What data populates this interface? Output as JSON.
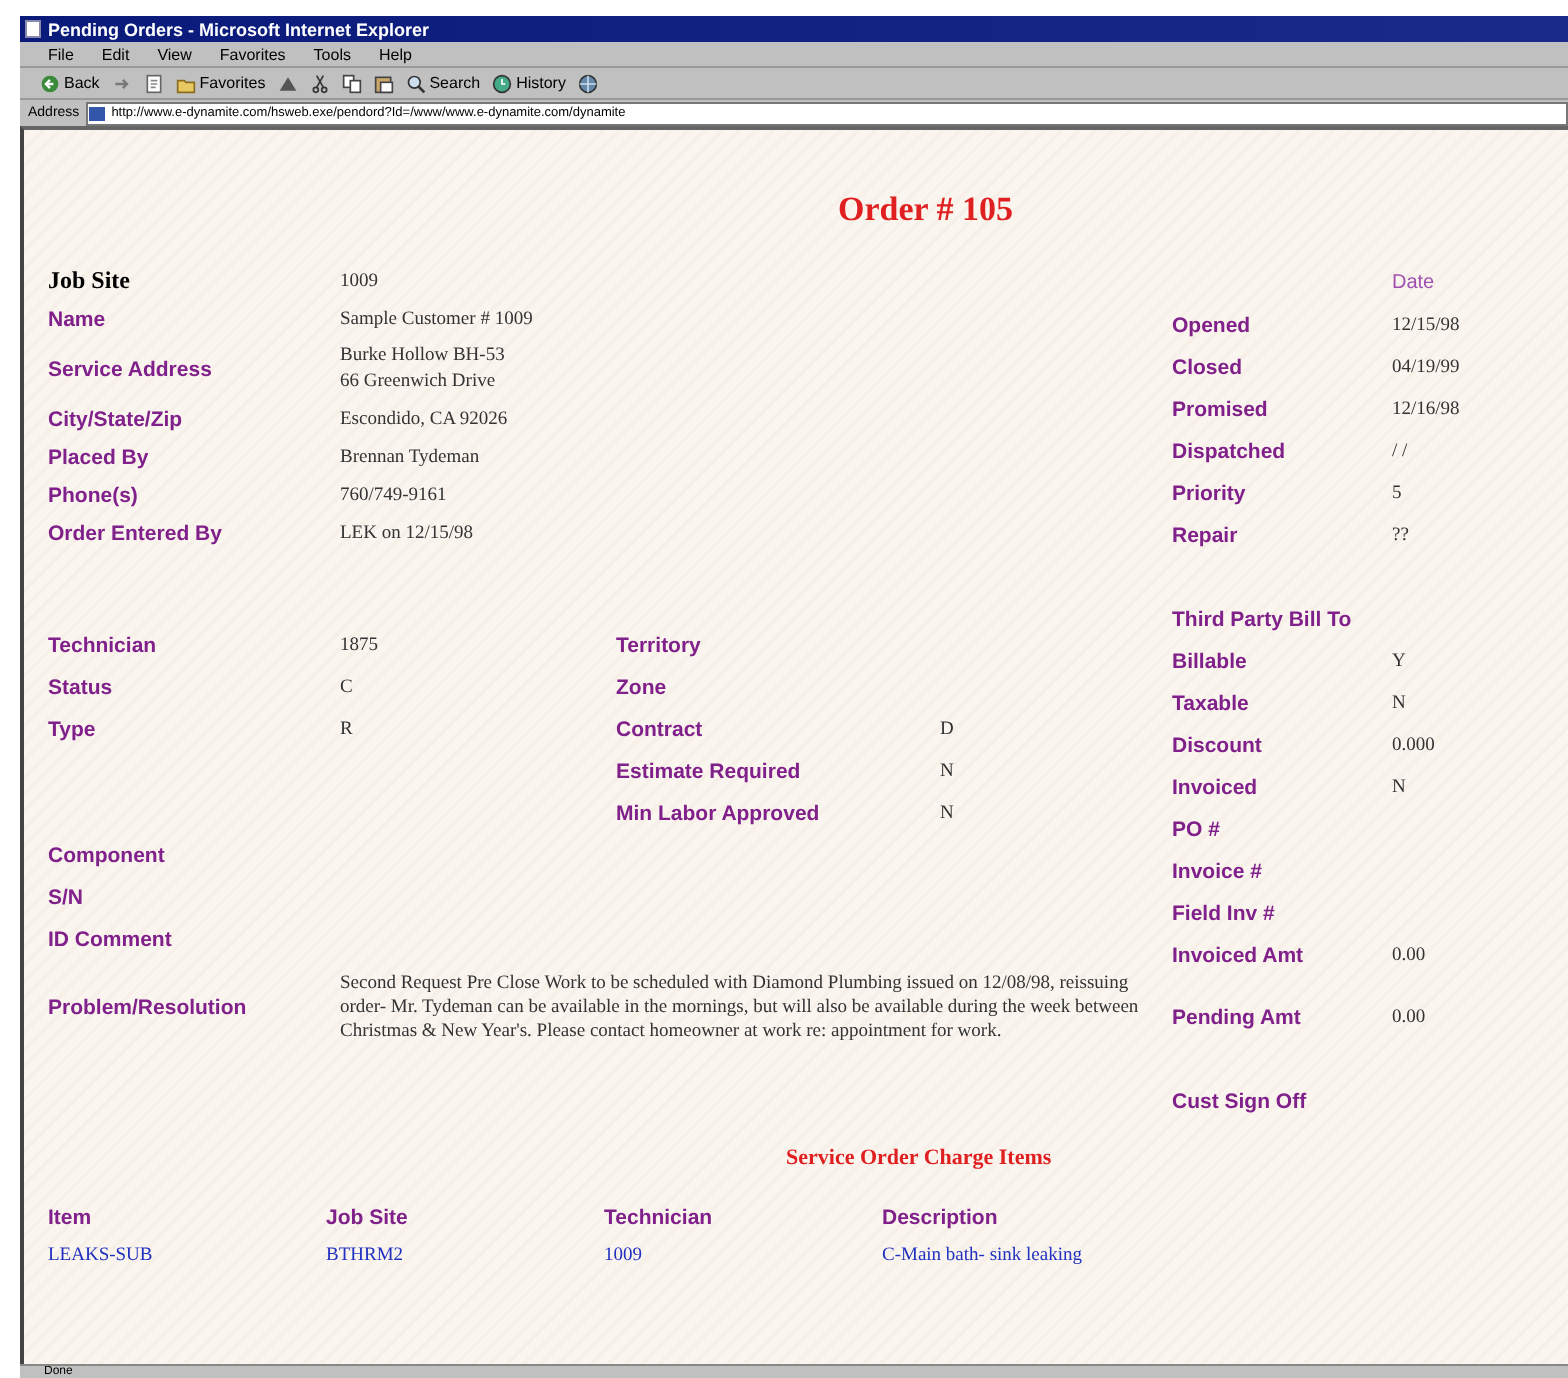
{
  "window": {
    "title": "Pending Orders - Microsoft Internet Explorer"
  },
  "menu": [
    "File",
    "Edit",
    "View",
    "Favorites",
    "Tools",
    "Help"
  ],
  "toolbar": [
    {
      "kind": "back",
      "label": "Back"
    },
    {
      "kind": "forward"
    },
    {
      "kind": "stop"
    },
    {
      "kind": "favorites",
      "label": "Favorites"
    },
    {
      "kind": "history-icon"
    },
    {
      "kind": "cut"
    },
    {
      "kind": "copy"
    },
    {
      "kind": "paste"
    },
    {
      "kind": "search",
      "label": "Search"
    },
    {
      "kind": "history",
      "label": "History"
    },
    {
      "kind": "globe"
    }
  ],
  "address": {
    "label": "Address",
    "value": "http://www.e-dynamite.com/hsweb.exe/pendord?Id=/www/www.e-dynamite.com/dynamite"
  },
  "page": {
    "title": "Order # 105",
    "customer": [
      {
        "kind": "heading",
        "label": "Job Site",
        "lines": [
          "1009"
        ]
      },
      {
        "kind": "field",
        "label": "Name",
        "lines": [
          "Sample Customer # 1009"
        ]
      },
      {
        "kind": "field",
        "label": "Service Address",
        "lines": [
          "Burke Hollow BH-53",
          "66 Greenwich Drive"
        ]
      },
      {
        "kind": "field",
        "label": "City/State/Zip",
        "lines": [
          "Escondido, CA 92026"
        ]
      },
      {
        "kind": "field",
        "label": "Placed By",
        "lines": [
          "Brennan Tydeman"
        ]
      },
      {
        "kind": "field",
        "label": "Phone(s)",
        "lines": [
          "760/749-9161"
        ]
      },
      {
        "kind": "field",
        "label": "Order Entered By",
        "lines": [
          "LEK on 12/15/98"
        ]
      }
    ],
    "work": [
      {
        "label": "Technician",
        "value": "1875",
        "label_2": "Territory"
      },
      {
        "label": "Status",
        "value": "C",
        "label_2": "Zone"
      },
      {
        "label": "Type",
        "value": "R",
        "label_2": "Contract",
        "value_2": "D"
      },
      {
        "label_2": "Estimate Required",
        "value_2": "N"
      },
      {
        "label_2": "Min Labor Approved",
        "value_2": "N"
      },
      {
        "label": "Component"
      },
      {
        "label": "S/N"
      },
      {
        "label": "ID Comment"
      }
    ],
    "problem": {
      "label": "Problem/Resolution",
      "text": "Second Request Pre Close Work to be scheduled with Diamond Plumbing issued on 12/08/98, reissuing order- Mr. Tydeman can be available in the mornings, but will also be available during the week between Christmas & New Year's. Please contact homeowner at work re: appointment for work."
    },
    "dates": {
      "header": "Date",
      "rows": [
        {
          "label": "Opened",
          "value": "12/15/98"
        },
        {
          "label": "Closed",
          "value": "04/19/99"
        },
        {
          "label": "Promised",
          "value": "12/16/98"
        },
        {
          "label": "Dispatched",
          "value": "/ /"
        },
        {
          "label": "Priority",
          "value": "5"
        },
        {
          "label": "Repair",
          "value": "??"
        }
      ]
    },
    "billing": {
      "header": "Third Party Bill To",
      "rows": [
        {
          "label": "Billable",
          "value": "Y"
        },
        {
          "label": "Taxable",
          "value": "N"
        },
        {
          "label": "Discount",
          "value": "0.000"
        },
        {
          "label": "Invoiced",
          "value": "N"
        },
        {
          "label": "PO #"
        },
        {
          "label": "Invoice #"
        },
        {
          "label": "Field Inv #"
        },
        {
          "label": "Invoiced Amt",
          "value": "0.00"
        }
      ]
    },
    "pending": {
      "label": "Pending Amt",
      "value": "0.00"
    },
    "signoff": {
      "label": "Cust Sign Off"
    },
    "charges": {
      "title": "Service Order Charge Items",
      "columns": [
        "Item",
        "Job Site",
        "Technician",
        "Description"
      ],
      "rows": [
        [
          "LEAKS-SUB",
          "BTHRM2",
          "1009",
          "C-Main bath- sink leaking"
        ]
      ]
    }
  },
  "status_bar": {
    "text": "Done"
  }
}
